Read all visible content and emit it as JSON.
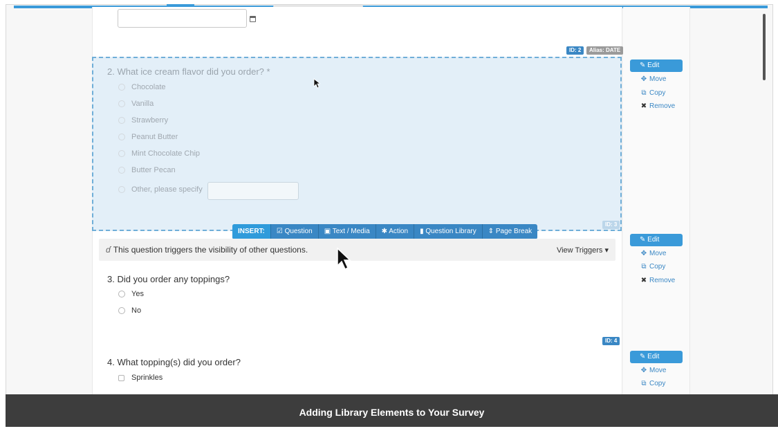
{
  "date_field": {
    "value": ""
  },
  "tags_q1": {
    "id": "ID: 2",
    "alias": "Alias: DATE"
  },
  "q2": {
    "title": "2. What ice cream flavor did you order? *",
    "options": [
      "Chocolate",
      "Vanilla",
      "Strawberry",
      "Peanut Butter",
      "Mint Chocolate Chip",
      "Butter Pecan",
      "Other, please specify"
    ],
    "other_value": "",
    "id": "ID: 3"
  },
  "insert_bar": {
    "label": "INSERT:",
    "question": "Question",
    "text_media": "Text / Media",
    "action": "Action",
    "question_library": "Question Library",
    "page_break": "Page Break"
  },
  "trigger": {
    "text": "This question triggers the visibility of other questions.",
    "view": "View Triggers"
  },
  "q3": {
    "title": "3. Did you order any toppings?",
    "options": [
      "Yes",
      "No"
    ],
    "id": "ID: 4"
  },
  "q4": {
    "title": "4. What topping(s) did you order?",
    "options": [
      "Sprinkles"
    ]
  },
  "actions": {
    "edit": "Edit",
    "move": "Move",
    "copy": "Copy",
    "remove": "Remove"
  },
  "caption": "Adding Library Elements to Your Survey",
  "icons": [
    "calendar-icon",
    "pencil-icon",
    "move-icon",
    "copy-icon",
    "remove-icon",
    "checkbox-icon",
    "image-icon",
    "gear-icon",
    "bookmark-icon",
    "sort-icon",
    "branch-icon",
    "caret-down-icon",
    "cursor-icon"
  ],
  "colors": {
    "accent": "#3a9ad9",
    "selected_bg": "#e3eff8",
    "caption_bg": "#3d3d3d"
  }
}
